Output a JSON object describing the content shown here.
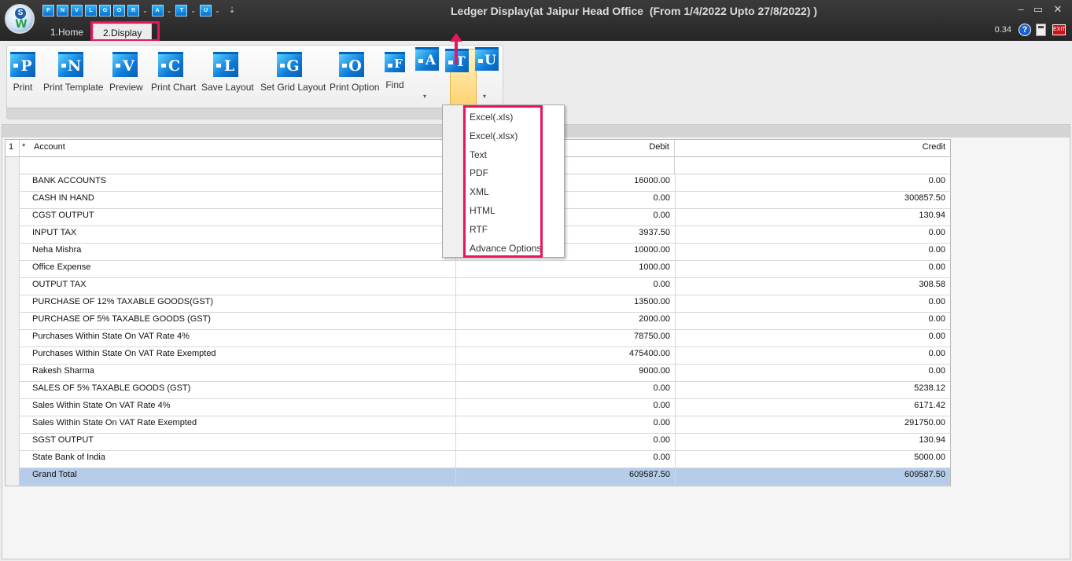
{
  "window": {
    "title": "Ledger Display(at Jaipur Head Office  (From 1/4/2022 Upto 27/8/2022) )",
    "version": "0.34",
    "controls": [
      "–",
      "▭",
      "✕"
    ]
  },
  "logo": {
    "top": "S",
    "bottom": "W"
  },
  "qat": {
    "buttons": [
      "P",
      "N",
      "V",
      "L",
      "G",
      "O",
      "R",
      "A",
      "T",
      "U"
    ],
    "more": "⇣"
  },
  "tabs": [
    "1.Home",
    "2.Display"
  ],
  "active_tab": "2.Display",
  "ribbon": {
    "buttons": [
      {
        "letter": "P",
        "label": "Print"
      },
      {
        "letter": "N",
        "label": "Print Template"
      },
      {
        "letter": "V",
        "label": "Preview"
      },
      {
        "letter": "C",
        "label": "Print Chart"
      },
      {
        "letter": "L",
        "label": "Save Layout"
      },
      {
        "letter": "G",
        "label": "Set Grid Layout"
      },
      {
        "letter": "O",
        "label": "Print Option"
      },
      {
        "letter": "F",
        "label": "Find"
      }
    ],
    "small_buttons": [
      {
        "letter": "A"
      },
      {
        "letter": "T"
      },
      {
        "letter": "U"
      }
    ]
  },
  "export_menu": {
    "items": [
      "Excel(.xls)",
      "Excel(.xlsx)",
      "Text",
      "PDF",
      "XML",
      "HTML",
      "RTF",
      "Advance Options"
    ]
  },
  "grid": {
    "row_num_header": "1",
    "star_header": "*",
    "columns": [
      "Account",
      "Debit",
      "Credit"
    ],
    "rows": [
      {
        "account": "BANK ACCOUNTS",
        "debit": "16000.00",
        "credit": "0.00"
      },
      {
        "account": "CASH IN HAND",
        "debit": "0.00",
        "credit": "300857.50"
      },
      {
        "account": "CGST OUTPUT",
        "debit": "0.00",
        "credit": "130.94"
      },
      {
        "account": "INPUT TAX",
        "debit": "3937.50",
        "credit": "0.00"
      },
      {
        "account": "Neha Mishra",
        "debit": "10000.00",
        "credit": "0.00"
      },
      {
        "account": "Office Expense",
        "debit": "1000.00",
        "credit": "0.00"
      },
      {
        "account": "OUTPUT TAX",
        "debit": "0.00",
        "credit": "308.58"
      },
      {
        "account": "PURCHASE OF 12% TAXABLE GOODS(GST)",
        "debit": "13500.00",
        "credit": "0.00"
      },
      {
        "account": "PURCHASE OF 5% TAXABLE GOODS (GST)",
        "debit": "2000.00",
        "credit": "0.00"
      },
      {
        "account": "Purchases Within State On VAT Rate 4%",
        "debit": "78750.00",
        "credit": "0.00"
      },
      {
        "account": "Purchases Within State On VAT Rate Exempted",
        "debit": "475400.00",
        "credit": "0.00"
      },
      {
        "account": "Rakesh Sharma",
        "debit": "9000.00",
        "credit": "0.00"
      },
      {
        "account": "SALES OF 5% TAXABLE GOODS (GST)",
        "debit": "0.00",
        "credit": "5238.12"
      },
      {
        "account": "Sales Within State On VAT Rate 4%",
        "debit": "0.00",
        "credit": "6171.42"
      },
      {
        "account": "Sales Within State On VAT Rate Exempted",
        "debit": "0.00",
        "credit": "291750.00"
      },
      {
        "account": "SGST OUTPUT",
        "debit": "0.00",
        "credit": "130.94"
      },
      {
        "account": "State Bank of India",
        "debit": "0.00",
        "credit": "5000.00"
      }
    ],
    "total": {
      "account": "Grand Total",
      "debit": "609587.50",
      "credit": "609587.50"
    }
  },
  "colors": {
    "highlight": "#e6175b",
    "total_row": "#b6cde9",
    "icon_blue": "#0c79d6"
  }
}
